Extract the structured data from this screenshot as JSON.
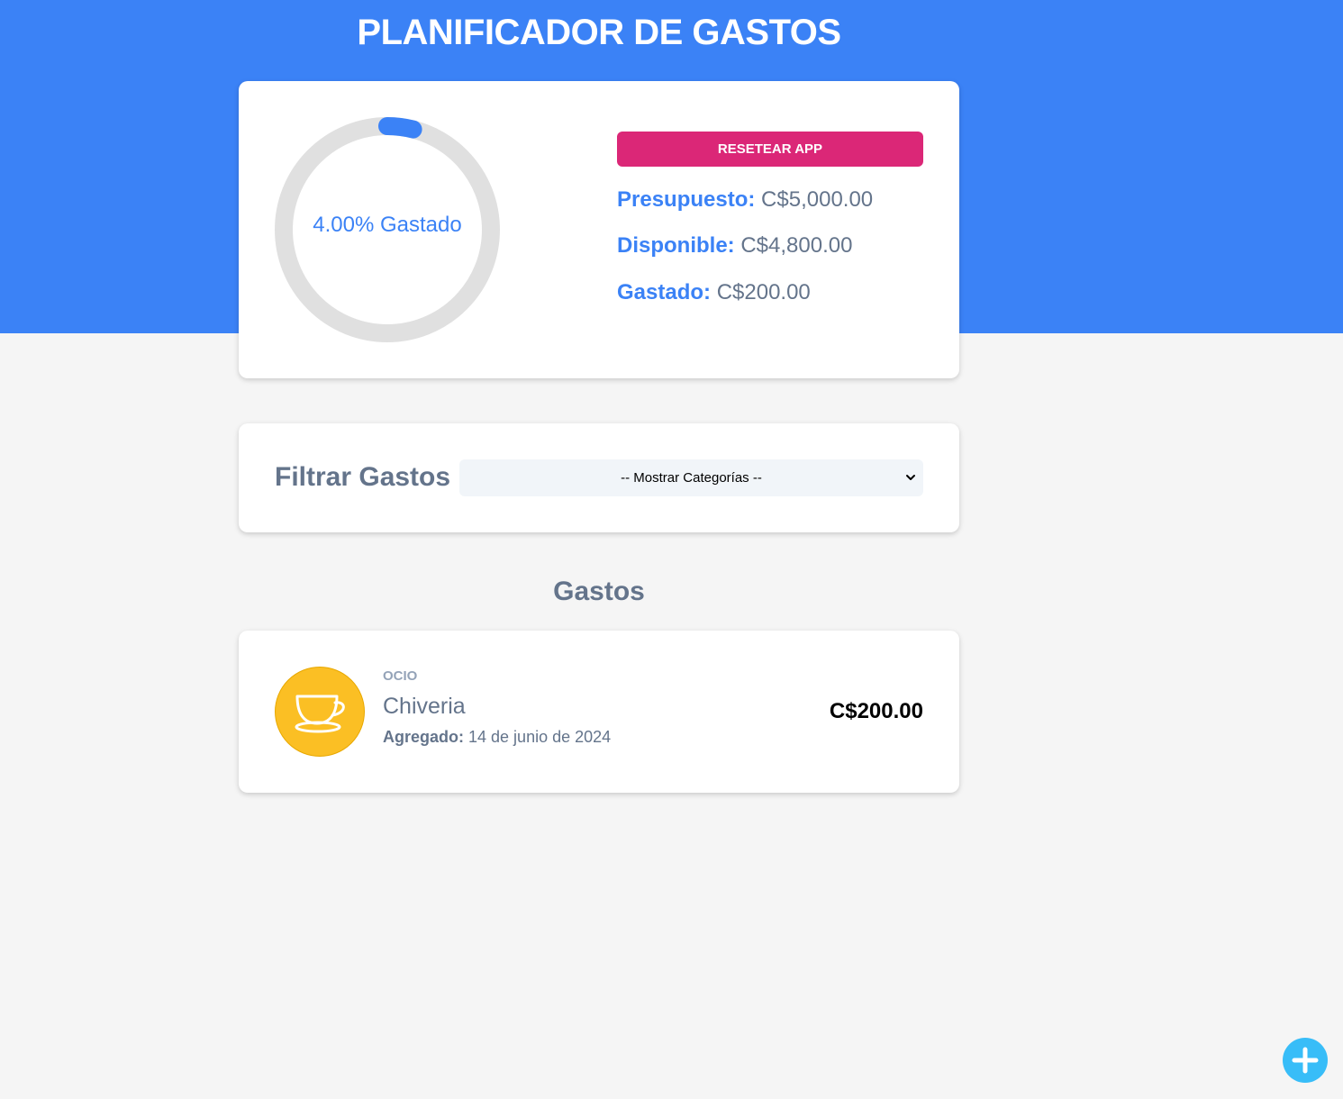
{
  "header": {
    "title": "PLANIFICADOR DE GASTOS"
  },
  "budget": {
    "percent_spent": 4.0,
    "progress_label": "4.00% Gastado",
    "reset_label": "RESETEAR APP",
    "budget_label": "Presupuesto:",
    "budget_value": "C$5,000.00",
    "available_label": "Disponible:",
    "available_value": "C$4,800.00",
    "spent_label": "Gastado:",
    "spent_value": "C$200.00"
  },
  "filter": {
    "label": "Filtrar Gastos",
    "selected": "-- Mostrar Categorías --"
  },
  "list": {
    "title": "Gastos",
    "items": [
      {
        "category": "OCIO",
        "name": "Chiveria",
        "date_label": "Agregado:",
        "date": "14 de junio de 2024",
        "amount": "C$200.00",
        "icon": "cup-icon"
      }
    ]
  },
  "colors": {
    "primary": "#3b82f6",
    "reset": "#db2777",
    "category_ocio": "#fbbf24",
    "fab": "#38bdf8"
  }
}
